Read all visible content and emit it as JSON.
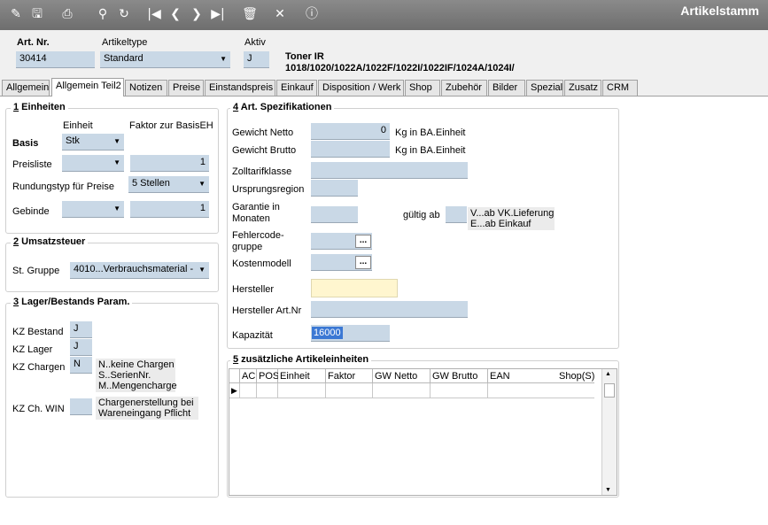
{
  "app": {
    "title": "Artikelstamm"
  },
  "toolbar": {
    "icons": [
      "edit-icon",
      "save-icon",
      "print-icon",
      "search-icon",
      "refresh-icon",
      "first-record-icon",
      "prev-record-icon",
      "next-record-icon",
      "last-record-icon",
      "delete-icon",
      "close-icon",
      "info-icon"
    ]
  },
  "header": {
    "art_nr_label": "Art. Nr.",
    "art_nr_value": "30414",
    "artikeltype_label": "Artikeltype",
    "artikeltype_value": "Standard",
    "aktiv_label": "Aktiv",
    "aktiv_value": "J",
    "desc_line1": "Toner IR",
    "desc_line2": "1018/1020/1022A/1022F/1022I/1022IF/1024A/1024I/"
  },
  "tabs": [
    "Allgemein",
    "Allgemein Teil2",
    "Notizen",
    "Preise",
    "Einstandspreis",
    "Einkauf",
    "Disposition / Werk",
    "Shop",
    "Zubehör",
    "Bilder",
    "Spezial",
    "Zusatz",
    "CRM"
  ],
  "active_tab": "Allgemein Teil2",
  "einheiten": {
    "num": "1",
    "title": " Einheiten",
    "col_einheit": "Einheit",
    "col_faktor": "Faktor zur BasisEH",
    "basis_label": "Basis",
    "basis_value": "Stk",
    "preisliste_label": "Preisliste",
    "preisliste_faktor": "1",
    "rundung_label": "Rundungstyp für Preise",
    "rundung_value": "5 Stellen",
    "gebinde_label": "Gebinde",
    "gebinde_faktor": "1"
  },
  "umsatzsteuer": {
    "num": "2",
    "title": " Umsatzsteuer",
    "gruppe_label": "St. Gruppe",
    "gruppe_value": "4010...Verbrauchsmaterial -"
  },
  "lager": {
    "num": "3",
    "title": " Lager/Bestands Param.",
    "kz_bestand_label": "KZ Bestand",
    "kz_bestand_value": "J",
    "kz_lager_label": "KZ Lager",
    "kz_lager_value": "J",
    "kz_chargen_label": "KZ Chargen",
    "kz_chargen_value": "N",
    "kz_chargen_note": "N..keine Chargen\nS..SerienNr.\nM..Mengencharge",
    "kz_chwin_label": "KZ Ch. WIN",
    "kz_chwin_value": "",
    "kz_chwin_note": "Chargenerstellung bei\nWareneingang Pflicht"
  },
  "spezifikationen": {
    "num": "4",
    "title": " Art. Spezifikationen",
    "gewicht_netto_label": "Gewicht Netto",
    "gewicht_netto_value": "0",
    "gewicht_netto_unit": "Kg in BA.Einheit",
    "gewicht_brutto_label": "Gewicht Brutto",
    "gewicht_brutto_value": "",
    "gewicht_brutto_unit": "Kg in BA.Einheit",
    "zolltarif_label": "Zolltarifklasse",
    "ursprung_label": "Ursprungsregion",
    "garantie_label": "Garantie in\nMonaten",
    "gueltig_label": "gültig ab",
    "gueltig_note": "V...ab VK.Lieferung\nE...ab Einkauf",
    "fehlercode_label": "Fehlercode-\ngruppe",
    "kostenmodell_label": "Kostenmodell",
    "hersteller_label": "Hersteller",
    "hersteller_artnr_label": "Hersteller Art.Nr",
    "kapazitaet_label": "Kapazität",
    "kapazitaet_value": "16000",
    "ellipsis": "..."
  },
  "zusatz": {
    "num": "5",
    "title": " zusätzliche Artikeleinheiten",
    "columns": [
      "AC",
      "POS",
      "Einheit",
      "Faktor",
      "GW Netto",
      "GW Brutto",
      "EAN",
      "Shop(S)"
    ]
  },
  "colors": {
    "field": "#c9d8e6",
    "toolbar": "#7a7a7a",
    "selection": "#3b78d4",
    "highlight": "#fff6cf"
  }
}
